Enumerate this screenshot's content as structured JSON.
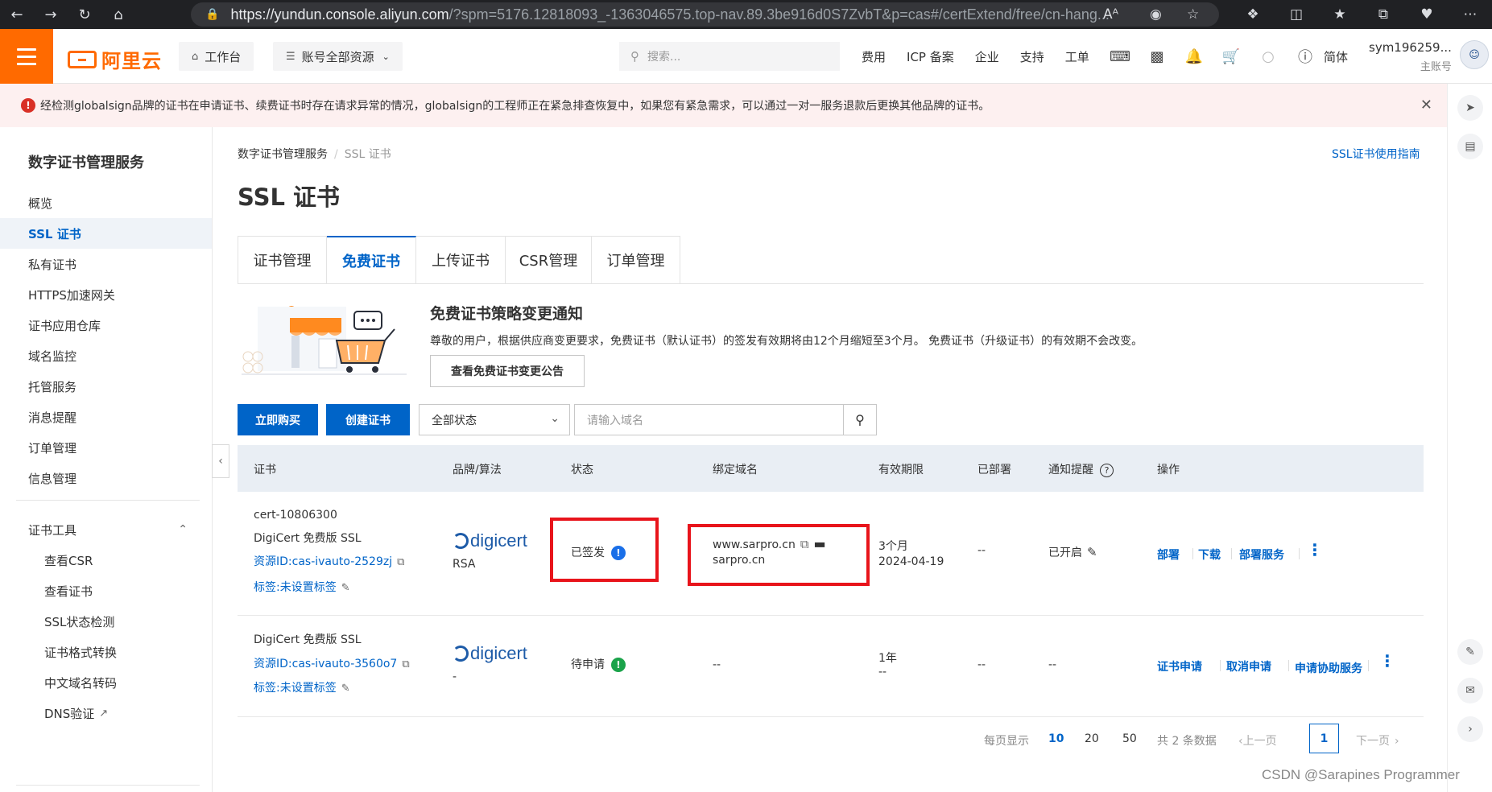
{
  "browser": {
    "url_host": "https://yundun.console.aliyun.com",
    "url_rest": "/?spm=5176.12818093_-1363046575.top-nav.89.3be916d0S7ZvbT&p=cas#/certExtend/free/cn-hang...",
    "read_aloud": "Aᴬ"
  },
  "header": {
    "logo": "阿里云",
    "workbench": "工作台",
    "resources": "账号全部资源",
    "search_placeholder": "搜索...",
    "links": [
      "费用",
      "ICP 备案",
      "企业",
      "支持",
      "工单"
    ],
    "lang": "简体",
    "username": "sym196259...",
    "account_type": "主账号"
  },
  "alert": {
    "text": "经检测globalsign品牌的证书在申请证书、续费证书时存在请求异常的情况，globalsign的工程师正在紧急排查恢复中，如果您有紧急需求，可以通过一对一服务退款后更换其他品牌的证书。"
  },
  "sidebar": {
    "title": "数字证书管理服务",
    "items": [
      "概览",
      "SSL 证书",
      "私有证书",
      "HTTPS加速网关",
      "证书应用仓库",
      "域名监控",
      "托管服务",
      "消息提醒",
      "订单管理",
      "信息管理"
    ],
    "tools_title": "证书工具",
    "tools": [
      "查看CSR",
      "查看证书",
      "SSL状态检测",
      "证书格式转换",
      "中文域名转码",
      "DNS验证"
    ]
  },
  "main": {
    "breadcrumb_root": "数字证书管理服务",
    "breadcrumb_current": "SSL 证书",
    "guide_link": "SSL证书使用指南",
    "title": "SSL 证书",
    "tabs": [
      "证书管理",
      "免费证书",
      "上传证书",
      "CSR管理",
      "订单管理"
    ],
    "notice_title": "免费证书策略变更通知",
    "notice_text": "尊敬的用户，根据供应商变更要求，免费证书（默认证书）的签发有效期将由12个月缩短至3个月。 免费证书（升级证书）的有效期不会改变。",
    "notice_button": "查看免费证书变更公告",
    "buy_button": "立即购买",
    "create_button": "创建证书",
    "status_filter": "全部状态",
    "domain_placeholder": "请输入域名"
  },
  "table": {
    "headers": [
      "证书",
      "品牌/算法",
      "状态",
      "绑定域名",
      "有效期限",
      "已部署",
      "通知提醒",
      "操作"
    ],
    "rows": [
      {
        "cert_id": "cert-10806300",
        "name": "DigiCert 免费版 SSL",
        "resource": "资源ID:cas-ivauto-2529zj",
        "tag": "标签:未设置标签",
        "brand": "digicert",
        "algo": "RSA",
        "status": "已签发",
        "domain1": "www.sarpro.cn",
        "domain2": "sarpro.cn",
        "period": "3个月",
        "expire": "2024-04-19",
        "deployed": "--",
        "notify": "已开启",
        "ops": [
          "部署",
          "下载",
          "部署服务"
        ]
      },
      {
        "name": "DigiCert 免费版 SSL",
        "resource": "资源ID:cas-ivauto-3560o7",
        "tag": "标签:未设置标签",
        "brand": "digicert",
        "algo": "-",
        "status": "待申请",
        "domain1": "--",
        "period": "1年",
        "expire": "--",
        "deployed": "--",
        "notify": "--",
        "ops": [
          "证书申请",
          "取消申请",
          "申请协助服务"
        ]
      }
    ]
  },
  "pager": {
    "per_page_label": "每页显示",
    "sizes": [
      "10",
      "20",
      "50"
    ],
    "total": "共 2 条数据",
    "prev": "上一页",
    "current": "1",
    "next": "下一页"
  },
  "watermark": "CSDN @Sarapines Programmer",
  "colors": {
    "accent": "#0064c8",
    "brand": "#ff6a00",
    "highlight": "#e8141b",
    "issued": "#1a6fe8",
    "pending": "#1aa34a"
  }
}
